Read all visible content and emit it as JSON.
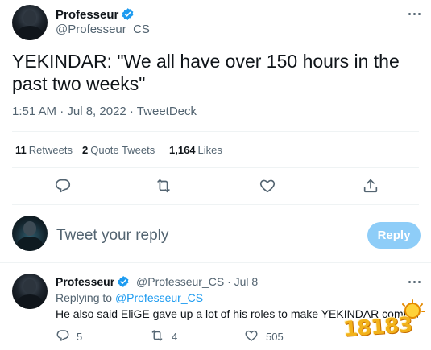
{
  "tweet": {
    "author_name": "Professeur",
    "author_handle": "@Professeur_CS",
    "text": "YEKINDAR: \"We all have over 150 hours in the past two weeks\"",
    "timestamp": "1:51 AM · Jul 8, 2022 · TweetDeck",
    "stats": {
      "retweets_count": "11",
      "retweets_label": "Retweets",
      "quote_count": "2",
      "quote_label": "Quote Tweets",
      "likes_count": "1,164",
      "likes_label": "Likes"
    },
    "action_icons": [
      "reply-icon",
      "retweet-icon",
      "like-icon",
      "share-icon"
    ]
  },
  "reply_box": {
    "placeholder": "Tweet your reply",
    "button_label": "Reply"
  },
  "reply": {
    "author_name": "Professeur",
    "author_handle": "@Professeur_CS",
    "date": "· Jul 8",
    "replying_prefix": "Replying to",
    "replying_to": "@Professeur_CS",
    "text": "He also said EliGE gave up a lot of his roles to make YEKINDAR comfortable",
    "reply_count": "5",
    "retweet_count": "4",
    "like_count": "505"
  },
  "watermark": {
    "text": "18183"
  },
  "colors": {
    "accent": "#1d9bf0",
    "reply_button_disabled": "#8ecdf8",
    "text_primary": "#0f1419",
    "text_secondary": "#536471",
    "divider": "#eff3f4"
  }
}
